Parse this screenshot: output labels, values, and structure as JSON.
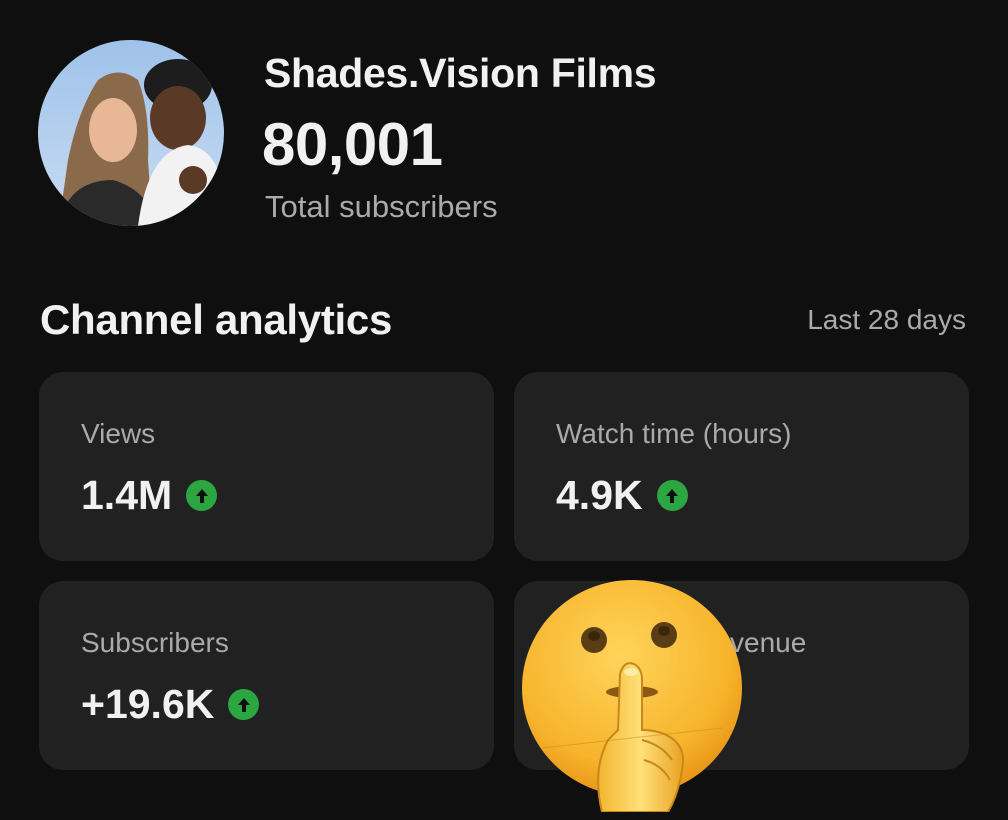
{
  "channel": {
    "name": "Shades.Vision Films",
    "subscriber_count": "80,001",
    "subscriber_label": "Total subscribers"
  },
  "analytics": {
    "title": "Channel analytics",
    "period": "Last 28 days",
    "cards": [
      {
        "label": "Views",
        "value": "1.4M",
        "trend": "up"
      },
      {
        "label": "Watch time (hours)",
        "value": "4.9K",
        "trend": "up"
      },
      {
        "label": "Subscribers",
        "value": "+19.6K",
        "trend": "up"
      },
      {
        "label": "venue",
        "value": "",
        "trend": ""
      }
    ]
  },
  "colors": {
    "background": "#0f0f0f",
    "card": "#212121",
    "up_indicator": "#2ba640",
    "muted_text": "#aaaaaa"
  },
  "icons": {
    "trend": "arrow-up-icon",
    "overlay": "shushing-face-emoji"
  }
}
